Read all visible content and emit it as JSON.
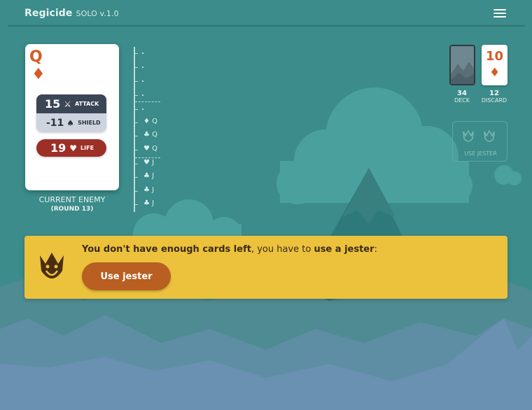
{
  "app": {
    "title": "Regicide",
    "subtitle": "SOLO v.1.0"
  },
  "enemy": {
    "rank": "Q",
    "suit": "♦",
    "attack": "15",
    "attack_label": "ATTACK",
    "shield": "-11",
    "shield_label": "SHIELD",
    "life": "19",
    "life_label": "LIFE",
    "caption": "CURRENT ENEMY",
    "round": "(ROUND 13)"
  },
  "ladder": [
    {
      "label": ""
    },
    {
      "label": ""
    },
    {
      "label": ""
    },
    {
      "label": ""
    },
    {
      "label": ""
    },
    {
      "label": "♦ Q"
    },
    {
      "label": "♣ Q"
    },
    {
      "label": "♥ Q"
    },
    {
      "label": "♥ J"
    },
    {
      "label": "♣ J"
    },
    {
      "label": "♣ J"
    },
    {
      "label": "♣ J"
    }
  ],
  "deck": {
    "count": "34",
    "label": "DECK"
  },
  "discard": {
    "rank": "10",
    "suit": "♦",
    "count": "12",
    "label": "DISCARD"
  },
  "jester": {
    "label": "USE JESTER"
  },
  "alert": {
    "text_bold1": "You don't have enough cards left",
    "text_mid": ", you have to ",
    "text_bold2": "use a jester",
    "text_end": ":",
    "button": "Use jester"
  },
  "colors": {
    "background": "#3a8a88",
    "accent": "#d55b25",
    "alert": "#ecc23c",
    "button": "#b85f21"
  }
}
